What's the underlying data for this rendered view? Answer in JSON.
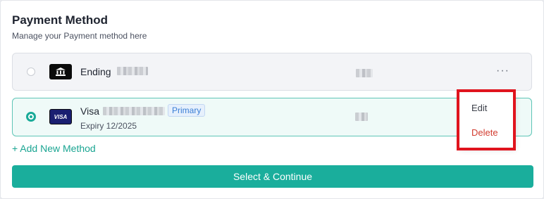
{
  "header": {
    "title": "Payment Method",
    "subtitle": "Manage your Payment method here"
  },
  "methods": [
    {
      "label": "Ending",
      "logo_icon": "bank-icon",
      "selected": false
    },
    {
      "label": "Visa",
      "logo_text": "VISA",
      "logo_icon": "visa-logo",
      "badge": "Primary",
      "expiry": "Expiry 12/2025",
      "selected": true
    }
  ],
  "more_icon": "···",
  "menu": {
    "edit": "Edit",
    "delete": "Delete"
  },
  "add_method": "+ Add New Method",
  "cta": "Select & Continue",
  "colors": {
    "accent": "#1aae9c",
    "danger": "#d23b2e",
    "highlight": "#e0141e",
    "badge": "#3a7fd6"
  }
}
